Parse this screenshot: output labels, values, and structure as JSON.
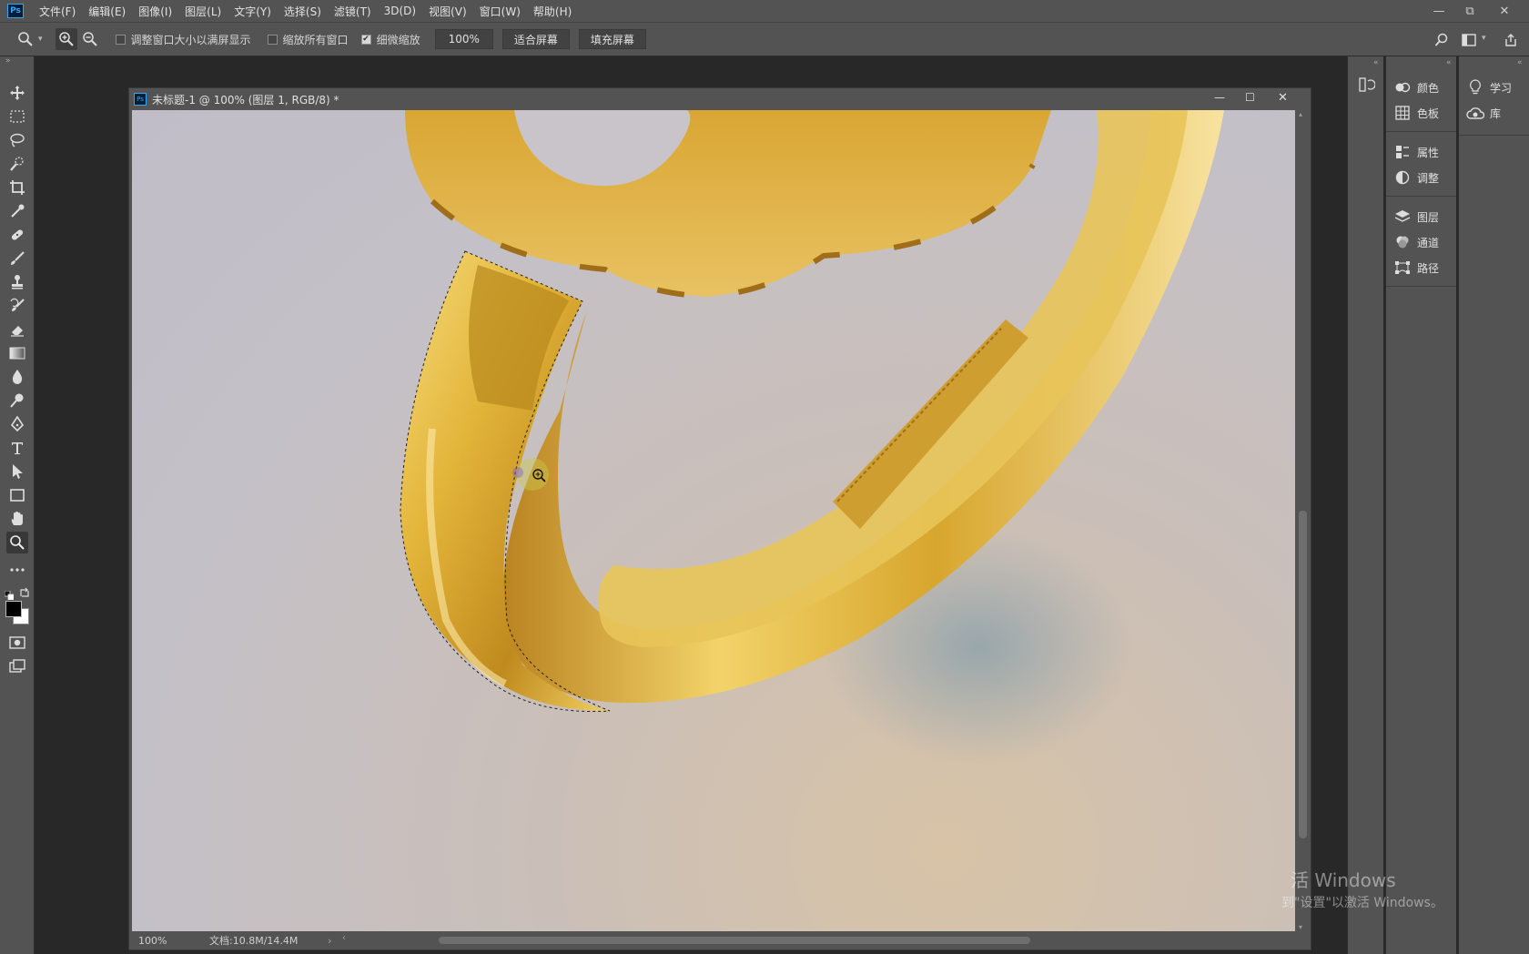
{
  "app": {
    "logo": "Ps"
  },
  "menu": [
    "文件(F)",
    "编辑(E)",
    "图像(I)",
    "图层(L)",
    "文字(Y)",
    "选择(S)",
    "滤镜(T)",
    "3D(D)",
    "视图(V)",
    "窗口(W)",
    "帮助(H)"
  ],
  "window_controls": {
    "minimize": "—",
    "restore": "⧉",
    "close": "✕"
  },
  "options_bar": {
    "tool_icon": "zoom-icon",
    "checkbox_resize": {
      "label": "调整窗口大小以满屏显示",
      "checked": false
    },
    "checkbox_all": {
      "label": "缩放所有窗口",
      "checked": false
    },
    "checkbox_scrubby": {
      "label": "细微缩放",
      "checked": true,
      "mark": "✔"
    },
    "zoom_value": "100%",
    "fit_screen": "适合屏幕",
    "fill_screen": "填充屏幕"
  },
  "document": {
    "title": "未标题-1 @ 100% (图层 1, RGB/8) *",
    "icon": "Ps",
    "zoom": "100%",
    "doc_size": "文档:10.8M/14.4M",
    "controls": {
      "minimize": "—",
      "maximize": "☐",
      "close": "✕"
    }
  },
  "panels": {
    "col1": [
      {
        "group": [
          {
            "label": "颜色",
            "icon": "color-icon"
          },
          {
            "label": "色板",
            "icon": "swatches-icon"
          }
        ]
      },
      {
        "group": [
          {
            "label": "属性",
            "icon": "properties-icon"
          },
          {
            "label": "调整",
            "icon": "adjustments-icon"
          }
        ]
      },
      {
        "group": [
          {
            "label": "图层",
            "icon": "layers-icon"
          },
          {
            "label": "通道",
            "icon": "channels-icon"
          },
          {
            "label": "路径",
            "icon": "paths-icon"
          }
        ]
      }
    ],
    "col2": [
      {
        "label": "学习",
        "icon": "learn-icon"
      },
      {
        "label": "库",
        "icon": "libraries-icon"
      }
    ]
  },
  "watermark": {
    "line1": "活 Windows",
    "line2": "到\"设置\"以激活 Windows。"
  },
  "colors": {
    "gold": "#e0b43a",
    "gold_light": "#f8e08a",
    "gold_dark": "#9c6d14",
    "accent": "#31a8ff"
  }
}
